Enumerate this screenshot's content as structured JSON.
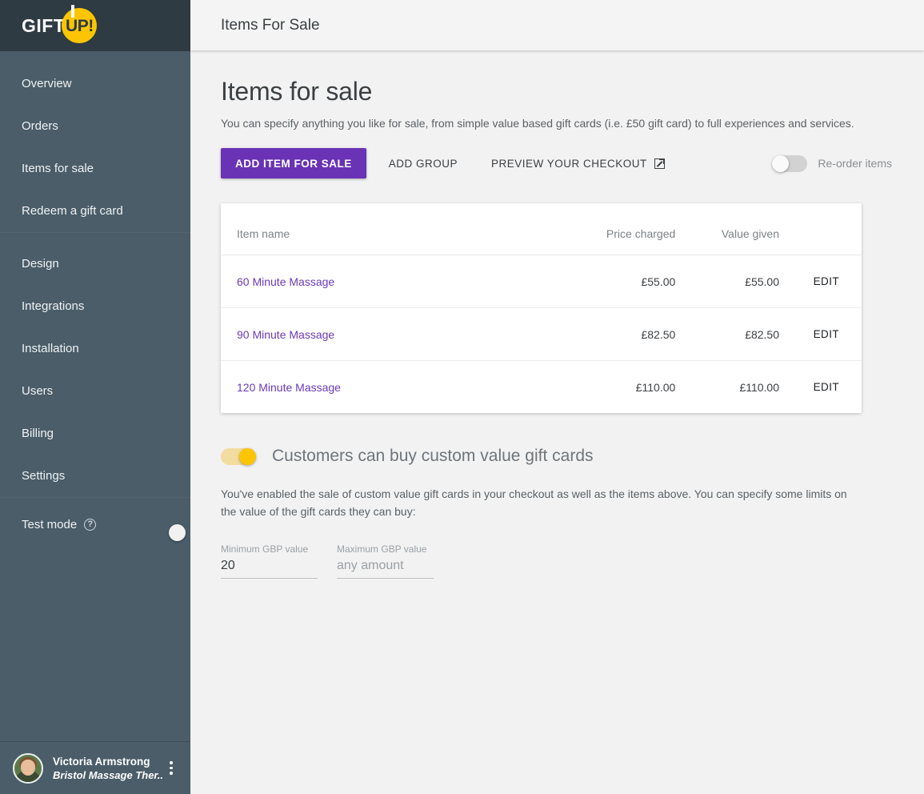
{
  "sidebar": {
    "logo": {
      "text": "GIFT",
      "badge": "UP!"
    },
    "nav_primary": [
      {
        "label": "Overview"
      },
      {
        "label": "Orders"
      },
      {
        "label": "Items for sale"
      },
      {
        "label": "Redeem a gift card"
      }
    ],
    "nav_secondary": [
      {
        "label": "Design"
      },
      {
        "label": "Integrations"
      },
      {
        "label": "Installation"
      },
      {
        "label": "Users"
      },
      {
        "label": "Billing"
      },
      {
        "label": "Settings"
      }
    ],
    "test_mode": {
      "label": "Test mode",
      "help_icon": "question-mark-circle-icon",
      "enabled": false
    },
    "user": {
      "name": "Victoria Armstrong",
      "organization": "Bristol Massage Ther...",
      "menu_icon": "kebab-menu-icon",
      "avatar_icon": "user-avatar"
    }
  },
  "topbar": {
    "title": "Items For Sale"
  },
  "page": {
    "title": "Items for sale",
    "subtitle": "You can specify anything you like for sale, from simple value based gift cards (i.e. £50 gift card) to full experiences and services."
  },
  "actions": {
    "add_item": "ADD ITEM FOR SALE",
    "add_group": "ADD GROUP",
    "preview_checkout": "PREVIEW YOUR CHECKOUT",
    "preview_icon": "external-link-icon",
    "reorder_label": "Re-order items",
    "reorder_enabled": false
  },
  "table": {
    "columns": [
      "Item name",
      "Price charged",
      "Value given",
      ""
    ],
    "rows": [
      {
        "name": "60 Minute Massage",
        "price": "£55.00",
        "value": "£55.00",
        "edit": "EDIT"
      },
      {
        "name": "90 Minute Massage",
        "price": "£82.50",
        "value": "£82.50",
        "edit": "EDIT"
      },
      {
        "name": "120 Minute Massage",
        "price": "£110.00",
        "value": "£110.00",
        "edit": "EDIT"
      }
    ]
  },
  "custom_value": {
    "toggle_enabled": true,
    "title": "Customers can buy custom value gift cards",
    "description": "You've enabled the sale of custom value gift cards in your checkout as well as the items above. You can specify some limits on the value of the gift cards they can buy:",
    "min_field": {
      "label": "Minimum GBP value",
      "value": "20",
      "placeholder": ""
    },
    "max_field": {
      "label": "Maximum GBP value",
      "value": "",
      "placeholder": "any amount"
    }
  },
  "colors": {
    "accent_purple": "#6a33b5",
    "brand_yellow": "#fdc500",
    "sidebar": "#4a5d69",
    "sidebar_dark": "#2e3b43",
    "link_purple": "#6a3ab5"
  }
}
